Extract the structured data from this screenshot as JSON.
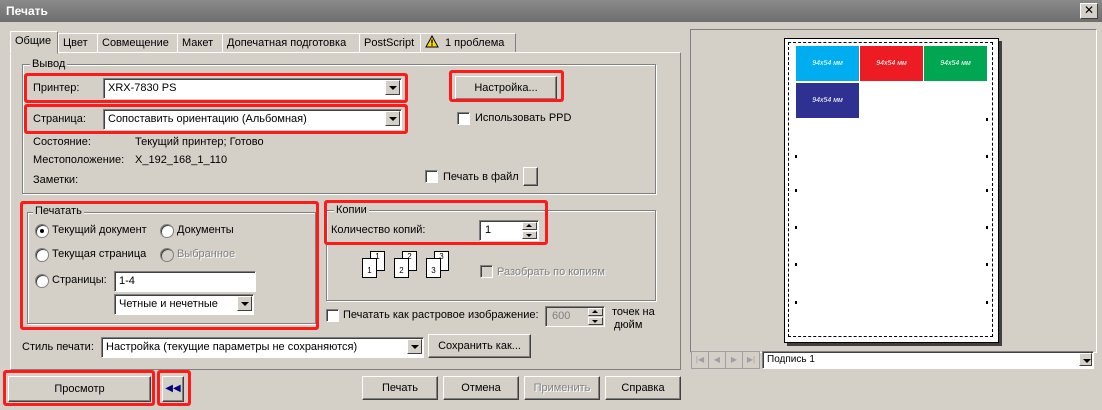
{
  "window": {
    "title": "Печать",
    "close_icon": "close-icon"
  },
  "tabs": [
    {
      "label": "Общие"
    },
    {
      "label": "Цвет"
    },
    {
      "label": "Совмещение"
    },
    {
      "label": "Макет"
    },
    {
      "label": "Допечатная подготовка"
    },
    {
      "label": "PostScript"
    },
    {
      "label": "1 проблема",
      "icon": "warning-icon"
    }
  ],
  "output": {
    "legend": "Вывод",
    "printer_label": "Принтер:",
    "printer_value": "XRX-7830 PS",
    "page_label": "Страница:",
    "page_value": "Сопоставить ориентацию (Альбомная)",
    "settings_button": "Настройка...",
    "use_ppd": "Использовать PPD",
    "status_label": "Состояние:",
    "status_value": "Текущий принтер; Готово",
    "location_label": "Местоположение:",
    "location_value": "X_192_168_1_110",
    "notes_label": "Заметки:",
    "print_to_file": "Печать в файл"
  },
  "print_range": {
    "legend": "Печатать",
    "current_document": "Текущий документ",
    "documents": "Документы",
    "current_page": "Текущая страница",
    "selection": "Выбранное",
    "pages_label": "Страницы:",
    "pages_value": "1-4",
    "odd_even_value": "Четные и нечетные"
  },
  "copies": {
    "legend": "Копии",
    "count_label": "Количество копий:",
    "count_value": "1",
    "collate": "Разобрать по копиям",
    "collate_icons": [
      "1",
      "1",
      "2",
      "2",
      "3",
      "3"
    ]
  },
  "raster": {
    "label": "Печатать как растровое изображение:",
    "dpi_value": "600",
    "dpi_unit_line1": "точек на",
    "dpi_unit_line2": "дюйм"
  },
  "print_style": {
    "label": "Стиль печати:",
    "value": "Настройка (текущие параметры не сохраняются)",
    "save_as_button": "Сохранить как..."
  },
  "preview": {
    "labels": [
      {
        "text": "94x54 мм",
        "color": "#00aeef"
      },
      {
        "text": "94x54 мм",
        "color": "#ed1c24"
      },
      {
        "text": "94x54 мм",
        "color": "#00a651"
      },
      {
        "text": "94x54 мм",
        "color": "#2e3192"
      }
    ],
    "page_select_value": "Подпись 1"
  },
  "bottom": {
    "preview_button": "Просмотр",
    "collapse_icon": "double-chevron-left-icon",
    "print_button": "Печать",
    "cancel_button": "Отмена",
    "apply_button": "Применить",
    "help_button": "Справка"
  },
  "colors": {
    "highlight": "#ff1a1a",
    "dialog_bg": "#d4d0c8"
  }
}
